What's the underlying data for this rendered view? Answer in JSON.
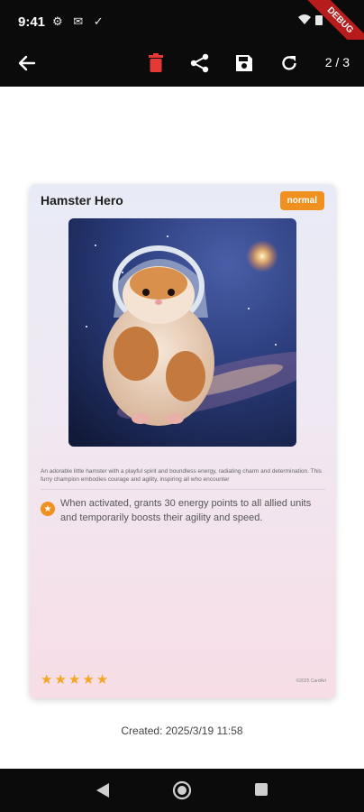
{
  "status_bar": {
    "time": "9:41",
    "left_icons": "⚙ ✉ ✓",
    "right_icons": "▼ ▮",
    "debug_label": "DEBUG"
  },
  "app_bar": {
    "back_icon": "arrow-left-icon",
    "delete_icon": "trash-icon",
    "share_icon": "share-icon",
    "save_icon": "save-icon",
    "refresh_icon": "refresh-icon",
    "page_indicator": "2 / 3",
    "delete_color": "#e53935"
  },
  "card": {
    "title": "Hamster Hero",
    "rarity": "normal",
    "description": "An adorable little hamster with a playful spirit and boundless energy, radiating charm and determination. This furry champion embodies courage and agility, inspiring all who encounter",
    "ability": "When activated, grants 30 energy points to all allied units and temporarily boosts their agility and speed.",
    "stars": 5,
    "copyright": "©2025 CardArt",
    "accent_color": "#f0901e"
  },
  "created_label": "Created: 2025/3/19 11:58",
  "nav_bar": {
    "back": "back-triangle-icon",
    "home": "home-circle-icon",
    "recents": "recents-square-icon"
  }
}
